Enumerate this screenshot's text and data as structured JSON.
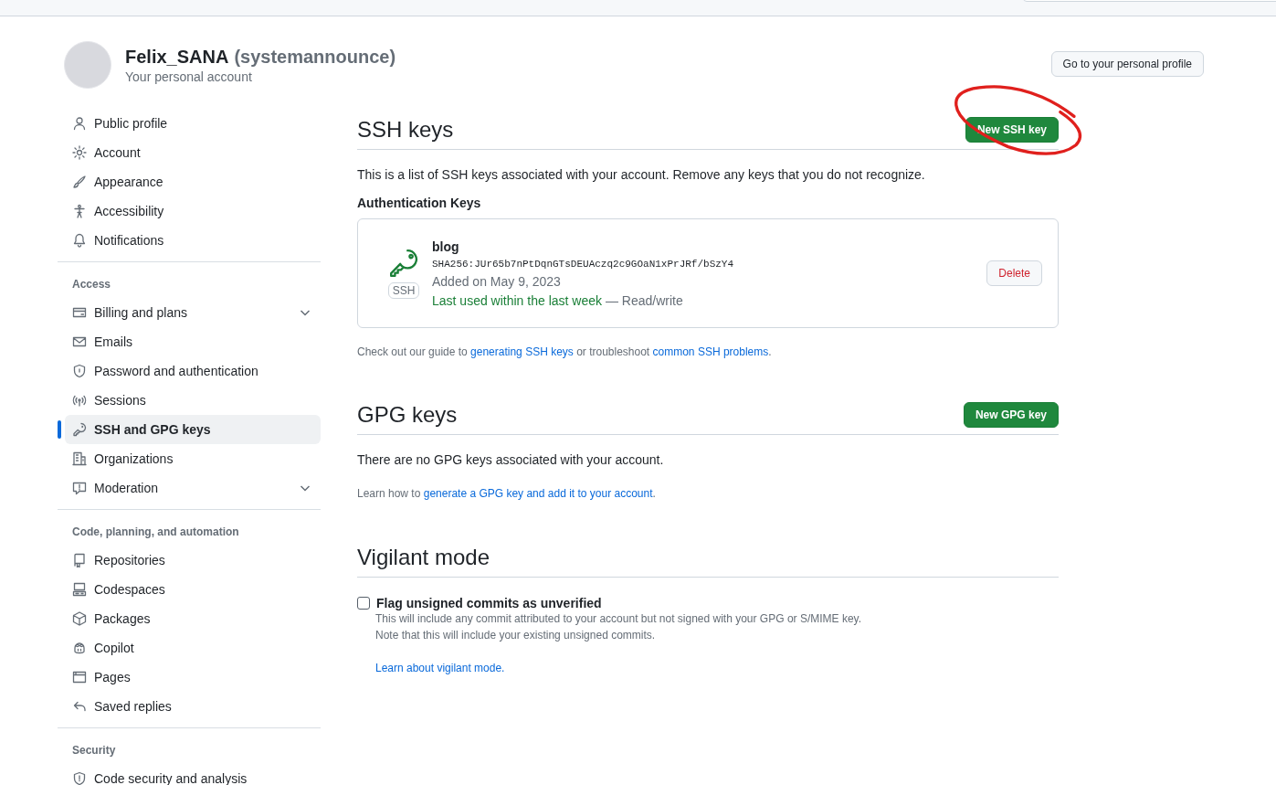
{
  "profile": {
    "name": "Felix_SANA",
    "login": "(systemannounce)",
    "subtitle": "Your personal account",
    "profile_button": "Go to your personal profile"
  },
  "sidebar": {
    "sections": [
      {
        "items": [
          {
            "label": "Public profile",
            "selected": false,
            "expandable": false
          },
          {
            "label": "Account",
            "selected": false,
            "expandable": false
          },
          {
            "label": "Appearance",
            "selected": false,
            "expandable": false
          },
          {
            "label": "Accessibility",
            "selected": false,
            "expandable": false
          },
          {
            "label": "Notifications",
            "selected": false,
            "expandable": false
          }
        ]
      },
      {
        "heading": "Access",
        "items": [
          {
            "label": "Billing and plans",
            "selected": false,
            "expandable": true
          },
          {
            "label": "Emails",
            "selected": false,
            "expandable": false
          },
          {
            "label": "Password and authentication",
            "selected": false,
            "expandable": false
          },
          {
            "label": "Sessions",
            "selected": false,
            "expandable": false
          },
          {
            "label": "SSH and GPG keys",
            "selected": true,
            "expandable": false
          },
          {
            "label": "Organizations",
            "selected": false,
            "expandable": false
          },
          {
            "label": "Moderation",
            "selected": false,
            "expandable": true
          }
        ]
      },
      {
        "heading": "Code, planning, and automation",
        "items": [
          {
            "label": "Repositories",
            "selected": false,
            "expandable": false
          },
          {
            "label": "Codespaces",
            "selected": false,
            "expandable": false
          },
          {
            "label": "Packages",
            "selected": false,
            "expandable": false
          },
          {
            "label": "Copilot",
            "selected": false,
            "expandable": false
          },
          {
            "label": "Pages",
            "selected": false,
            "expandable": false
          },
          {
            "label": "Saved replies",
            "selected": false,
            "expandable": false
          }
        ]
      },
      {
        "heading": "Security",
        "items": [
          {
            "label": "Code security and analysis",
            "selected": false,
            "expandable": false
          }
        ]
      }
    ]
  },
  "ssh": {
    "title": "SSH keys",
    "button": "New SSH key",
    "description": "This is a list of SSH keys associated with your account. Remove any keys that you do not recognize.",
    "subheading": "Authentication Keys",
    "keys": [
      {
        "badge": "SSH",
        "name": "blog",
        "fingerprint": "SHA256:JUr65b7nPtDqnGTsDEUAczq2c9GOaN1xPrJRf/bSzY4",
        "added": "Added on May 9, 2023",
        "last_used": "Last used within the last week",
        "access": "— Read/write",
        "delete": "Delete"
      }
    ],
    "guide": [
      {
        "kind": "text",
        "text": "Check out our guide to "
      },
      {
        "kind": "link",
        "text": "generating SSH keys"
      },
      {
        "kind": "text",
        "text": " or troubleshoot "
      },
      {
        "kind": "link",
        "text": "common SSH problems"
      },
      {
        "kind": "text",
        "text": "."
      }
    ]
  },
  "gpg": {
    "title": "GPG keys",
    "button": "New GPG key",
    "empty": "There are no GPG keys associated with your account.",
    "guide": [
      {
        "kind": "text",
        "text": "Learn how to "
      },
      {
        "kind": "link",
        "text": "generate a GPG key and add it to your account"
      },
      {
        "kind": "text",
        "text": "."
      }
    ]
  },
  "vigilant": {
    "title": "Vigilant mode",
    "checkbox": {
      "label": "Flag unsigned commits as unverified",
      "checked": false
    },
    "notes": [
      "This will include any commit attributed to your account but not signed with your GPG or S/MIME key.",
      "Note that this will include your existing unsigned commits."
    ],
    "link": "Learn about vigilant mode."
  }
}
